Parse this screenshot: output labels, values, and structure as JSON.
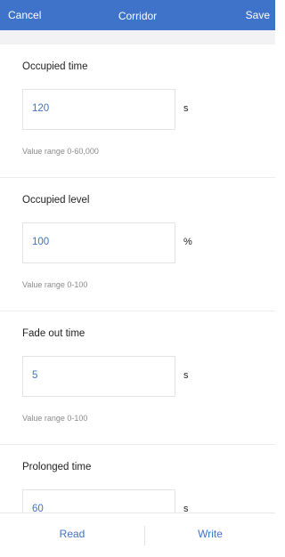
{
  "header": {
    "cancel_label": "Cancel",
    "title": "Corridor",
    "save_label": "Save",
    "background_color": "#3f72c9"
  },
  "fields": [
    {
      "label": "Occupied time",
      "value": "120",
      "unit": "s",
      "range": "Value range 0-60,000"
    },
    {
      "label": "Occupied level",
      "value": "100",
      "unit": "%",
      "range": "Value range 0-100"
    },
    {
      "label": "Fade out time",
      "value": "5",
      "unit": "s",
      "range": "Value range 0-100"
    },
    {
      "label": "Prolonged time",
      "value": "60",
      "unit": "s",
      "range": ""
    }
  ],
  "footer": {
    "read_label": "Read",
    "write_label": "Write"
  },
  "accent_color": "#3f72c9"
}
